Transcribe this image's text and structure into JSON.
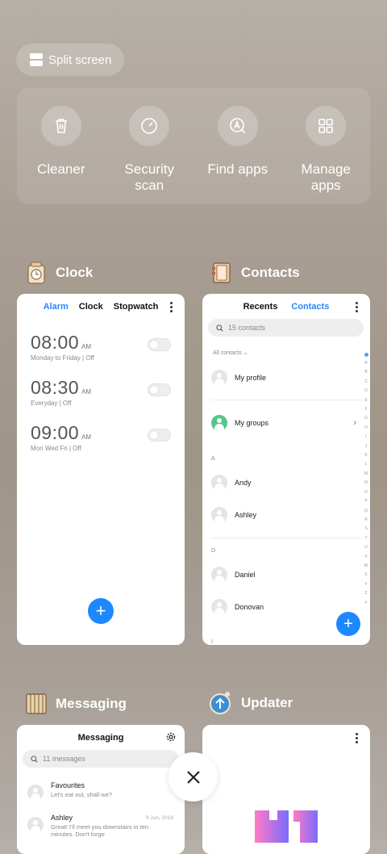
{
  "split_screen": {
    "label": "Split screen"
  },
  "tools": [
    {
      "label": "Cleaner",
      "icon": "trash-icon"
    },
    {
      "label": "Security\nscan",
      "icon": "shield-scan-icon"
    },
    {
      "label": "Find apps",
      "icon": "find-apps-icon"
    },
    {
      "label": "Manage\napps",
      "icon": "grid-icon"
    }
  ],
  "clock": {
    "app_name": "Clock",
    "tabs": [
      "Alarm",
      "Clock",
      "Stopwatch"
    ],
    "alarms": [
      {
        "time": "08:00",
        "ampm": "AM",
        "days": "Monday to Friday",
        "state": "Off"
      },
      {
        "time": "08:30",
        "ampm": "AM",
        "days": "Everyday",
        "state": "Off"
      },
      {
        "time": "09:00",
        "ampm": "AM",
        "days": "Mon Wed Fri",
        "state": "Off"
      }
    ],
    "add": "+"
  },
  "contacts": {
    "app_name": "Contacts",
    "tabs": [
      "Recents",
      "Contacts"
    ],
    "search_placeholder": "15 contacts",
    "filter": "All contacts",
    "my_profile": "My profile",
    "my_groups": "My groups",
    "section_a": "A",
    "section_d": "D",
    "section_next": "I",
    "rows": [
      "Andy",
      "Ashley",
      "Daniel",
      "Donovan"
    ],
    "index": [
      "A",
      "B",
      "C",
      "D",
      "E",
      "F",
      "G",
      "H",
      "I",
      "J",
      "K",
      "L",
      "M",
      "N",
      "O",
      "P",
      "Q",
      "R",
      "S",
      "T",
      "U",
      "V",
      "W",
      "X",
      "Y",
      "Z",
      "#"
    ],
    "add": "+"
  },
  "messaging": {
    "app_name": "Messaging",
    "title": "Messaging",
    "search_placeholder": "11 messages",
    "threads": [
      {
        "name": "Favourites",
        "preview": "Let's eat out, shall we?",
        "date": ""
      },
      {
        "name": "Ashley",
        "preview": "Great! I'll meet you downstairs in ten minutes. Don't forge",
        "date": "9 Jun, 2016"
      }
    ]
  },
  "updater": {
    "app_name": "Updater"
  },
  "colors": {
    "accent": "#1e88ff",
    "fab": "#1e88ff",
    "group_avatar": "#58c38a"
  }
}
